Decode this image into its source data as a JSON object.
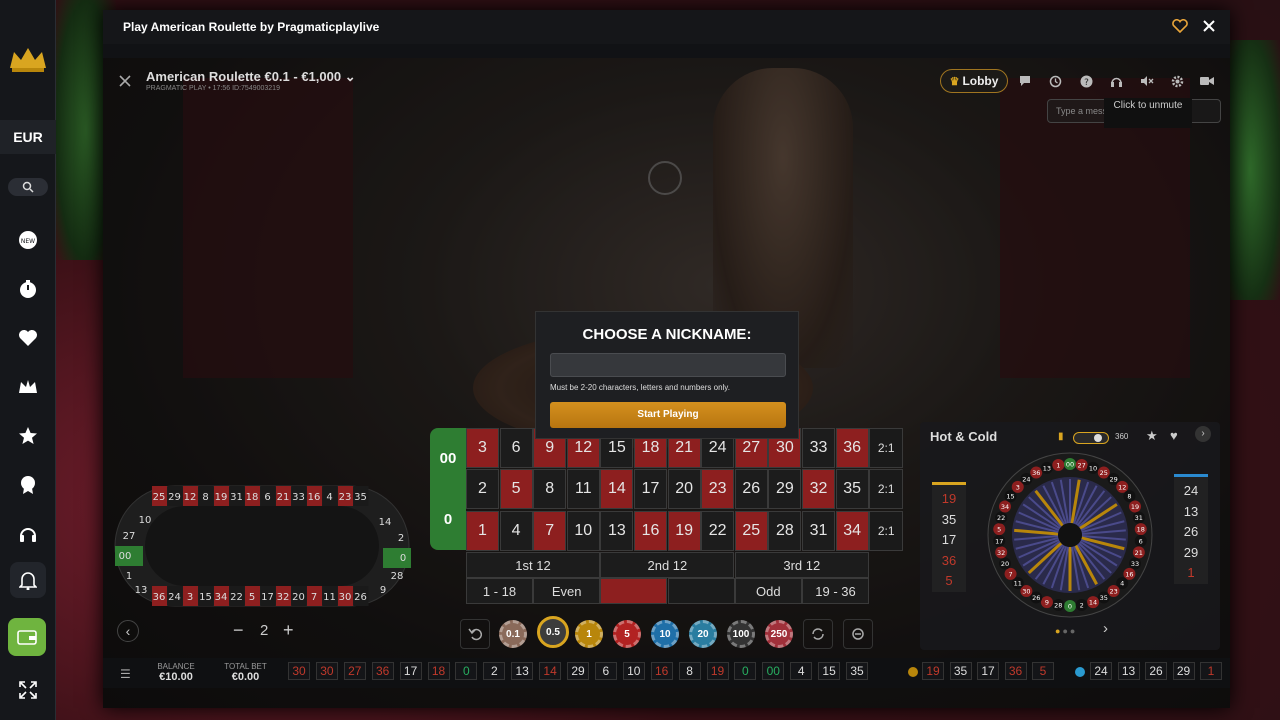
{
  "site": {
    "currency": "EUR"
  },
  "modal": {
    "title": "Play American Roulette by Pragmaticplaylive"
  },
  "game": {
    "title": "American Roulette €0.1 - €1,000",
    "subtitle": "PRAGMATIC PLAY • 17:56 ID:7549003219",
    "lobby_label": "Lobby",
    "chat_placeholder": "Type a message",
    "unmute_label": "Click to unmute"
  },
  "nickname_dialog": {
    "heading": "CHOOSE A NICKNAME:",
    "hint": "Must be 2-20 characters, letters and numbers only.",
    "button": "Start Playing"
  },
  "grid": {
    "zero": "0",
    "double_zero": "00",
    "rows": [
      [
        {
          "n": "3",
          "c": "r"
        },
        {
          "n": "6",
          "c": "b"
        },
        {
          "n": "9",
          "c": "r"
        },
        {
          "n": "12",
          "c": "r"
        },
        {
          "n": "15",
          "c": "b"
        },
        {
          "n": "18",
          "c": "r"
        },
        {
          "n": "21",
          "c": "r"
        },
        {
          "n": "24",
          "c": "b"
        },
        {
          "n": "27",
          "c": "r"
        },
        {
          "n": "30",
          "c": "r"
        },
        {
          "n": "33",
          "c": "b"
        },
        {
          "n": "36",
          "c": "r"
        }
      ],
      [
        {
          "n": "2",
          "c": "b"
        },
        {
          "n": "5",
          "c": "r"
        },
        {
          "n": "8",
          "c": "b"
        },
        {
          "n": "11",
          "c": "b"
        },
        {
          "n": "14",
          "c": "r"
        },
        {
          "n": "17",
          "c": "b"
        },
        {
          "n": "20",
          "c": "b"
        },
        {
          "n": "23",
          "c": "r"
        },
        {
          "n": "26",
          "c": "b"
        },
        {
          "n": "29",
          "c": "b"
        },
        {
          "n": "32",
          "c": "r"
        },
        {
          "n": "35",
          "c": "b"
        }
      ],
      [
        {
          "n": "1",
          "c": "r"
        },
        {
          "n": "4",
          "c": "b"
        },
        {
          "n": "7",
          "c": "r"
        },
        {
          "n": "10",
          "c": "b"
        },
        {
          "n": "13",
          "c": "b"
        },
        {
          "n": "16",
          "c": "r"
        },
        {
          "n": "19",
          "c": "r"
        },
        {
          "n": "22",
          "c": "b"
        },
        {
          "n": "25",
          "c": "r"
        },
        {
          "n": "28",
          "c": "b"
        },
        {
          "n": "31",
          "c": "b"
        },
        {
          "n": "34",
          "c": "r"
        }
      ]
    ],
    "column_bets": [
      "2:1",
      "2:1",
      "2:1"
    ],
    "dozens": [
      "1st 12",
      "2nd 12",
      "3rd 12"
    ],
    "outside": [
      "1 - 18",
      "Even",
      "",
      "",
      "Odd",
      "19 - 36"
    ]
  },
  "racetrack": {
    "top": [
      "25",
      "29",
      "12",
      "8",
      "19",
      "31",
      "18",
      "6",
      "21",
      "33",
      "16",
      "4",
      "23",
      "35"
    ],
    "bottom": [
      "36",
      "24",
      "3",
      "15",
      "34",
      "22",
      "5",
      "17",
      "32",
      "20",
      "7",
      "11",
      "30",
      "26"
    ],
    "left": [
      "10",
      "27",
      "00",
      "1",
      "13"
    ],
    "right": [
      "14",
      "2",
      "0",
      "28",
      "9"
    ]
  },
  "hot_cold": {
    "title": "Hot & Cold",
    "count": "360",
    "hot": [
      "19",
      "35",
      "17",
      "36",
      "5"
    ],
    "cold": [
      "24",
      "13",
      "26",
      "29",
      "1"
    ],
    "wheel_numbers": [
      "0",
      "28",
      "9",
      "26",
      "30",
      "11",
      "7",
      "20",
      "32",
      "17",
      "5",
      "22",
      "34",
      "15",
      "3",
      "24",
      "36",
      "13",
      "1",
      "00",
      "27",
      "10",
      "25",
      "29",
      "12",
      "8",
      "19",
      "31",
      "18",
      "6",
      "21",
      "33",
      "16",
      "4",
      "23",
      "35",
      "14",
      "2"
    ]
  },
  "controls": {
    "multiplier": "2",
    "chips": [
      {
        "v": "0.1",
        "color": "#8a6a5a"
      },
      {
        "v": "0.5",
        "color": "#3c3c3c"
      },
      {
        "v": "1",
        "color": "#b8860b"
      },
      {
        "v": "5",
        "color": "#b22222"
      },
      {
        "v": "10",
        "color": "#1f6fa8"
      },
      {
        "v": "20",
        "color": "#2a7da0"
      },
      {
        "v": "100",
        "color": "#333333"
      },
      {
        "v": "250",
        "color": "#a0303a"
      }
    ]
  },
  "footer": {
    "balance_label": "BALANCE",
    "balance_value": "€10.00",
    "total_bet_label": "TOTAL BET",
    "total_bet_value": "€0.00",
    "history": [
      {
        "n": "30",
        "c": "r"
      },
      {
        "n": "30",
        "c": "r"
      },
      {
        "n": "27",
        "c": "r"
      },
      {
        "n": "36",
        "c": "r"
      },
      {
        "n": "17",
        "c": "b"
      },
      {
        "n": "18",
        "c": "r"
      },
      {
        "n": "0",
        "c": "g"
      },
      {
        "n": "2",
        "c": "b"
      },
      {
        "n": "13",
        "c": "b"
      },
      {
        "n": "14",
        "c": "r"
      },
      {
        "n": "29",
        "c": "b"
      },
      {
        "n": "6",
        "c": "b"
      },
      {
        "n": "10",
        "c": "b"
      },
      {
        "n": "16",
        "c": "r"
      },
      {
        "n": "8",
        "c": "b"
      },
      {
        "n": "19",
        "c": "r"
      },
      {
        "n": "0",
        "c": "g"
      },
      {
        "n": "00",
        "c": "g"
      },
      {
        "n": "4",
        "c": "b"
      },
      {
        "n": "15",
        "c": "b"
      },
      {
        "n": "35",
        "c": "b"
      }
    ],
    "hot_strip": [
      "19",
      "35",
      "17",
      "36",
      "5"
    ],
    "cold_strip": [
      "24",
      "13",
      "26",
      "29",
      "1"
    ]
  }
}
